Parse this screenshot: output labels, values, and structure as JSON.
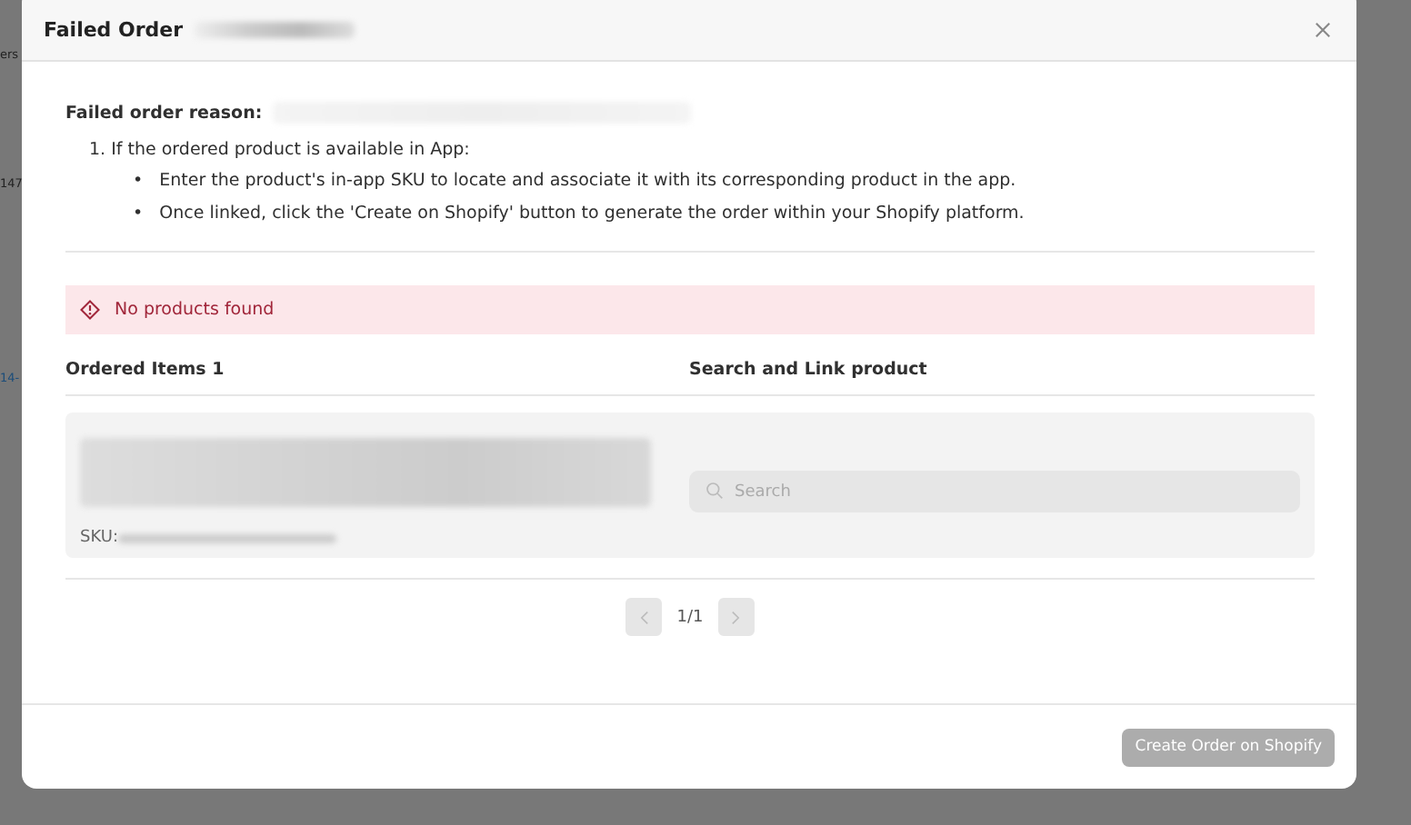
{
  "background_page": {
    "fragments": [
      "ers",
      "147",
      "14-"
    ]
  },
  "dialog": {
    "title": "Failed Order",
    "title_blurred": true,
    "reason_label": "Failed order reason:",
    "reason_blurred": true,
    "instructions": {
      "step": "1. If the ordered product is available in App:",
      "bullets": [
        {
          "marker": "•",
          "text": "Enter the product's in-app SKU to locate and associate it with its corresponding product in the app."
        },
        {
          "marker": "•",
          "text": "Once linked, click the 'Create on Shopify' button to generate the order within your Shopify platform."
        }
      ]
    },
    "alert": {
      "text": "No products found"
    },
    "columns": [
      "Ordered Items 1",
      "Search and Link product"
    ],
    "item": {
      "name_blurred": true,
      "sku_label": "SKU:",
      "sku_blurred": true,
      "search": {
        "placeholder": "Search"
      }
    },
    "pagination": {
      "page": "1/1",
      "prev_disabled": true,
      "next_disabled": true
    },
    "footer": {
      "button": {
        "label": "Create Order on Shopify",
        "disabled": true
      }
    }
  }
}
